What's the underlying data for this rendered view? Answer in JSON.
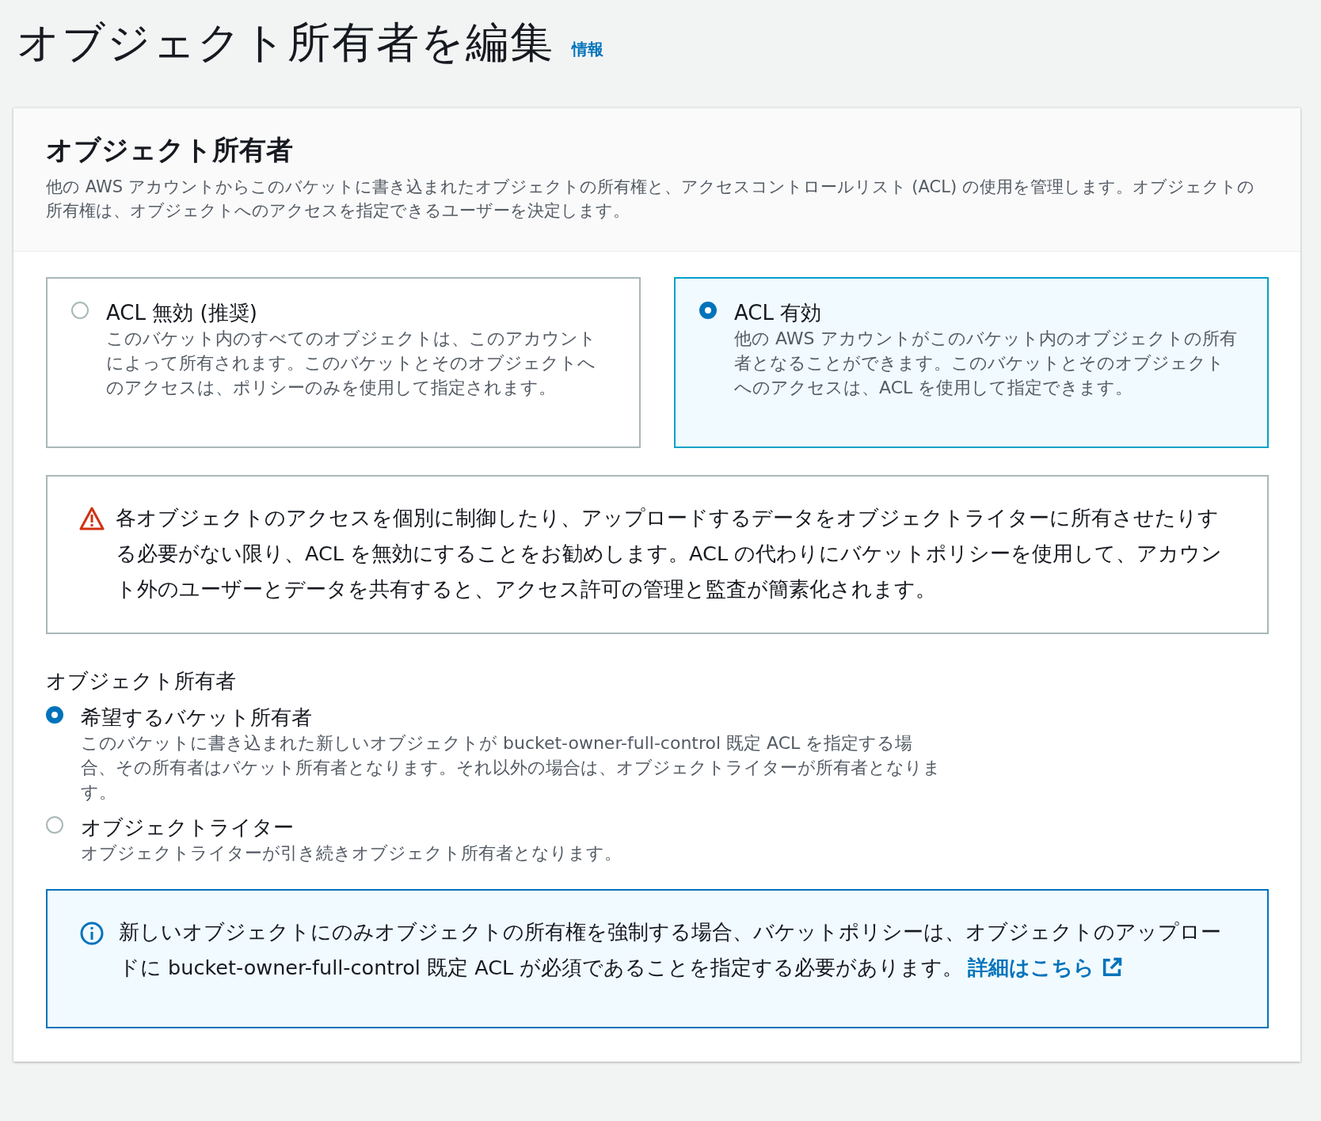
{
  "page_title": "オブジェクト所有者を編集",
  "info_link": "情報",
  "panel": {
    "title": "オブジェクト所有者",
    "description": "他の AWS アカウントからこのバケットに書き込まれたオブジェクトの所有権と、アクセスコントロールリスト (ACL) の使用を管理します。オブジェクトの所有権は、オブジェクトへのアクセスを指定できるユーザーを決定します。"
  },
  "acl_options": [
    {
      "label": "ACL 無効 (推奨)",
      "description": "このバケット内のすべてのオブジェクトは、このアカウントによって所有されます。このバケットとそのオブジェクトへのアクセスは、ポリシーのみを使用して指定されます。",
      "selected": false
    },
    {
      "label": "ACL 有効",
      "description": "他の AWS アカウントがこのバケット内のオブジェクトの所有者となることができます。このバケットとそのオブジェクトへのアクセスは、ACL を使用して指定できます。",
      "selected": true
    }
  ],
  "warning": {
    "text": "各オブジェクトのアクセスを個別に制御したり、アップロードするデータをオブジェクトライターに所有させたりする必要がない限り、ACL を無効にすることをお勧めします。ACL の代わりにバケットポリシーを使用して、アカウント外のユーザーとデータを共有すると、アクセス許可の管理と監査が簡素化されます。"
  },
  "ownership": {
    "label": "オブジェクト所有者",
    "options": [
      {
        "label": "希望するバケット所有者",
        "description": "このバケットに書き込まれた新しいオブジェクトが bucket-owner-full-control 既定 ACL を指定する場合、その所有者はバケット所有者となります。それ以外の場合は、オブジェクトライターが所有者となります。",
        "selected": true
      },
      {
        "label": "オブジェクトライター",
        "description": "オブジェクトライターが引き続きオブジェクト所有者となります。",
        "selected": false
      }
    ]
  },
  "info_alert": {
    "text": "新しいオブジェクトにのみオブジェクトの所有権を強制する場合、バケットポリシーは、オブジェクトのアップロードに bucket-owner-full-control 既定 ACL が必須であることを指定する必要があります。",
    "link": "詳細はこちら"
  }
}
